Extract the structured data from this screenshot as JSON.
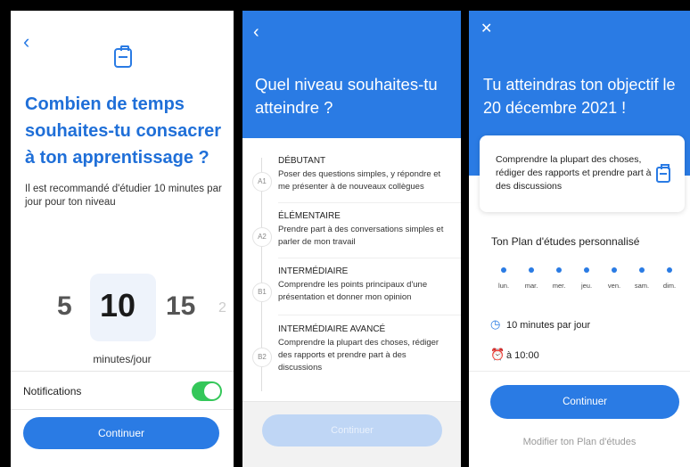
{
  "colors": {
    "accent": "#2a7be4",
    "toggle_on": "#34c759",
    "disabled_button": "#bfd6f5"
  },
  "screen1": {
    "back_icon": "chevron-left-icon",
    "header_icon": "briefcase-icon",
    "title": "Combien de temps souhaites-tu consacrer à ton apprentissage ?",
    "description": "Il est recommandé d'étudier 10 minutes par jour pour ton niveau",
    "picker": {
      "prev2": "5",
      "selected": "10",
      "next": "15",
      "next2": "2"
    },
    "unit": "minutes/jour",
    "notifications_label": "Notifications",
    "notifications_on": true,
    "continue_label": "Continuer"
  },
  "screen2": {
    "back_icon": "chevron-left-icon",
    "title": "Quel niveau souhaites-tu atteindre ?",
    "levels": [
      {
        "code": "A1",
        "name": "DÉBUTANT",
        "desc": "Poser des questions simples, y répondre et me présenter à de nouveaux collègues"
      },
      {
        "code": "A2",
        "name": "ÉLÉMENTAIRE",
        "desc": "Prendre part à des conversations simples et parler de mon travail"
      },
      {
        "code": "B1",
        "name": "INTERMÉDIAIRE",
        "desc": "Comprendre les points principaux d'une présentation et donner mon opinion"
      },
      {
        "code": "B2",
        "name": "INTERMÉDIAIRE AVANCÉ",
        "desc": "Comprendre la plupart des choses, rédiger des rapports et prendre part à des discussions"
      }
    ],
    "continue_label": "Continuer"
  },
  "screen3": {
    "close_icon": "close-icon",
    "title": "Tu atteindras ton objectif le 20 décembre 2021 !",
    "goal_text": "Comprendre la plupart des choses, rédiger des rapports et prendre part à des discussions",
    "goal_icon": "briefcase-icon",
    "plan_title": "Ton Plan d'études personnalisé",
    "days": [
      "lun.",
      "mar.",
      "mer.",
      "jeu.",
      "ven.",
      "sam.",
      "dim."
    ],
    "time_per_day": "10 minutes par jour",
    "reminder_time": "à 10:00",
    "continue_label": "Continuer",
    "modify_label": "Modifier ton Plan d'études"
  }
}
